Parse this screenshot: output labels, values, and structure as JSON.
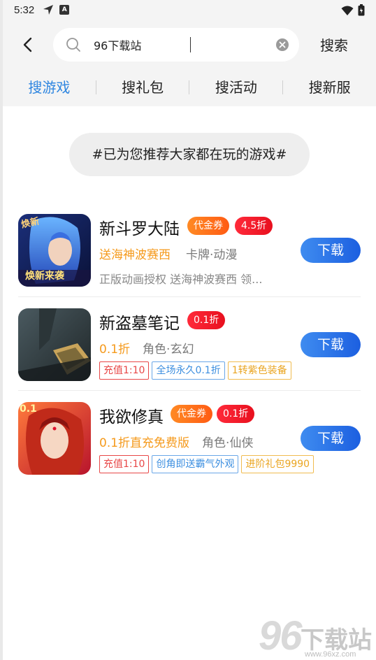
{
  "status_bar": {
    "time": "5:32",
    "nav_icon": "navigation-arrow-icon",
    "a_label": "A"
  },
  "header": {
    "search_value": "96下载站",
    "search_button": "搜索"
  },
  "tabs": [
    {
      "label": "搜游戏",
      "active": true
    },
    {
      "label": "搜礼包",
      "active": false
    },
    {
      "label": "搜活动",
      "active": false
    },
    {
      "label": "搜新服",
      "active": false
    }
  ],
  "recommendation": "#已为您推荐大家都在玩的游戏#",
  "games": [
    {
      "name": "新斗罗大陆",
      "badges": [
        "代金券",
        "4.5折"
      ],
      "highlight": "送海神波赛西",
      "category": "卡牌·动漫",
      "desc": "正版动画授权 送海神波赛西 领...",
      "icon_text_top": "焕新",
      "icon_text_bottom": "焕新来袭",
      "download": "下载"
    },
    {
      "name": "新盗墓笔记",
      "badges": [
        "0.1折"
      ],
      "highlight": "0.1折",
      "category": "角色·玄幻",
      "tags": [
        "充值1:10",
        "全场永久0.1折",
        "1转紫色装备"
      ],
      "download": "下载"
    },
    {
      "name": "我欲修真",
      "badges": [
        "代金券",
        "0.1折"
      ],
      "highlight": "0.1折直充免费版",
      "category": "角色·仙侠",
      "tags": [
        "充值1:10",
        "创角即送霸气外观",
        "进阶礼包9990"
      ],
      "icon_text_top": "0.1",
      "download": "下载"
    }
  ],
  "watermark": {
    "number": "96",
    "text": "下载站",
    "url": "www.96xz.com"
  },
  "colors": {
    "accent": "#2f86e0",
    "voucher": "#ff6a1a",
    "discount": "#ee1c2c",
    "highlight": "#f59a1c",
    "download": "#2a72e8"
  }
}
